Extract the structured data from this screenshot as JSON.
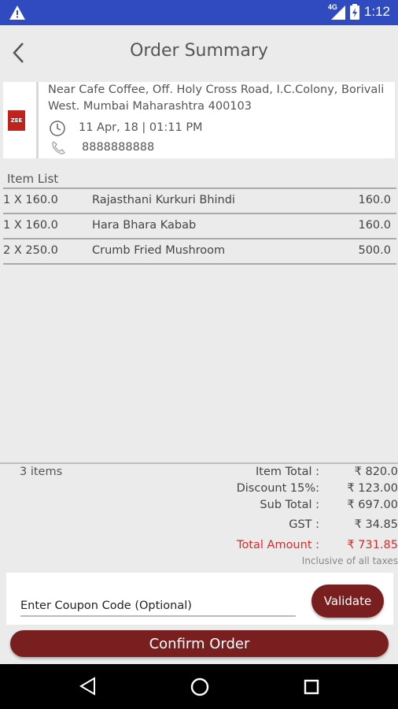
{
  "status_bar": {
    "time": "1:12",
    "network": "4G",
    "icons": [
      "warning-icon",
      "signal-icon",
      "battery-icon"
    ]
  },
  "app_bar": {
    "title": "Order Summary",
    "back_icon": "chevron-left-icon"
  },
  "store": {
    "address": "Near Cafe Coffee, Off. Holy Cross Road, I.C.Colony, Borivali West. Mumbai Maharashtra 400103",
    "datetime": "11 Apr, 18 | 01:11 PM",
    "phone": "8888888888",
    "logo_text": "ZEE"
  },
  "item_list": {
    "label": "Item List",
    "items": [
      {
        "qty": "1 X 160.0",
        "name": "Rajasthani Kurkuri Bhindi",
        "amount": "160.0"
      },
      {
        "qty": "1 X 160.0",
        "name": "Hara Bhara Kabab",
        "amount": "160.0"
      },
      {
        "qty": "2 X 250.0",
        "name": "Crumb Fried Mushroom",
        "amount": "500.0"
      }
    ]
  },
  "summary": {
    "items_count": "3 items",
    "item_total_label": "Item Total :",
    "item_total_value": "₹ 820.0",
    "discount_label": "Discount 15%:",
    "discount_value": "₹ 123.00",
    "sub_total_label": "Sub Total :",
    "sub_total_value": "₹ 697.00",
    "gst_label": "GST  :",
    "gst_value": "₹ 34.85",
    "total_label": "Total Amount :",
    "total_value": "₹ 731.85",
    "tax_note": "Inclusive of all taxes"
  },
  "coupon": {
    "value": "Enter Coupon Code (Optional)",
    "validate_label": "Validate"
  },
  "confirm_label": "Confirm Order",
  "colors": {
    "status_bar": "#2f4bbf",
    "accent": "#7a1f1f",
    "total_red": "#d92a2a",
    "background": "#ebebeb"
  }
}
